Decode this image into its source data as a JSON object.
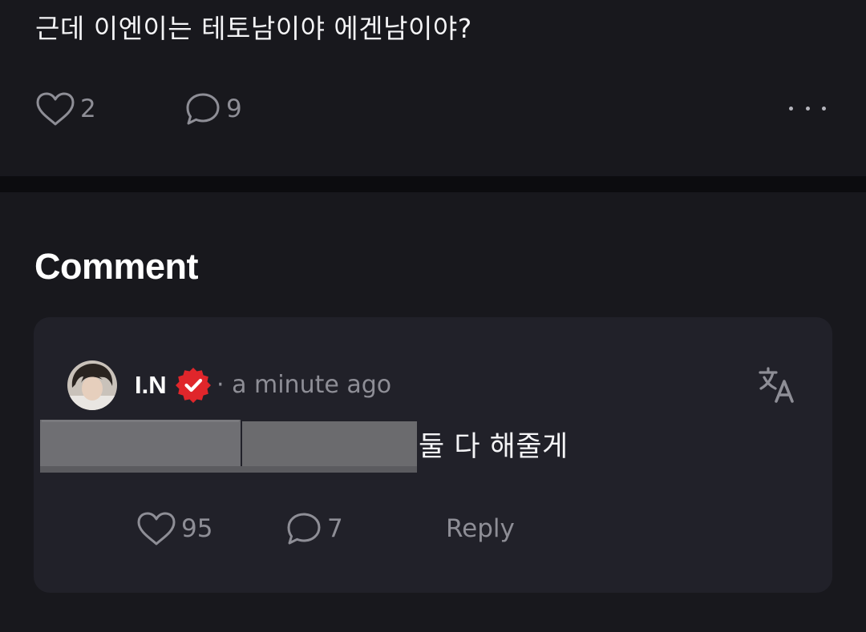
{
  "post": {
    "text": "근데 이엔이는 테토남이야 에겐남이야?",
    "likes": "2",
    "comments": "9",
    "more_icon": "more-horizontal-icon"
  },
  "section": {
    "title": "Comment"
  },
  "comment": {
    "author": "I.N",
    "verified_icon": "verified-badge-icon",
    "verified_color": "#e0262b",
    "timestamp": "· a minute ago",
    "text": "둘 다 해줄게",
    "redacted": true,
    "likes": "95",
    "replies": "7",
    "reply_label": "Reply",
    "translate_icon": "translate-icon"
  },
  "colors": {
    "background": "#121216",
    "surface": "#18181d",
    "card": "#212129",
    "muted_text": "#8e8e96"
  }
}
